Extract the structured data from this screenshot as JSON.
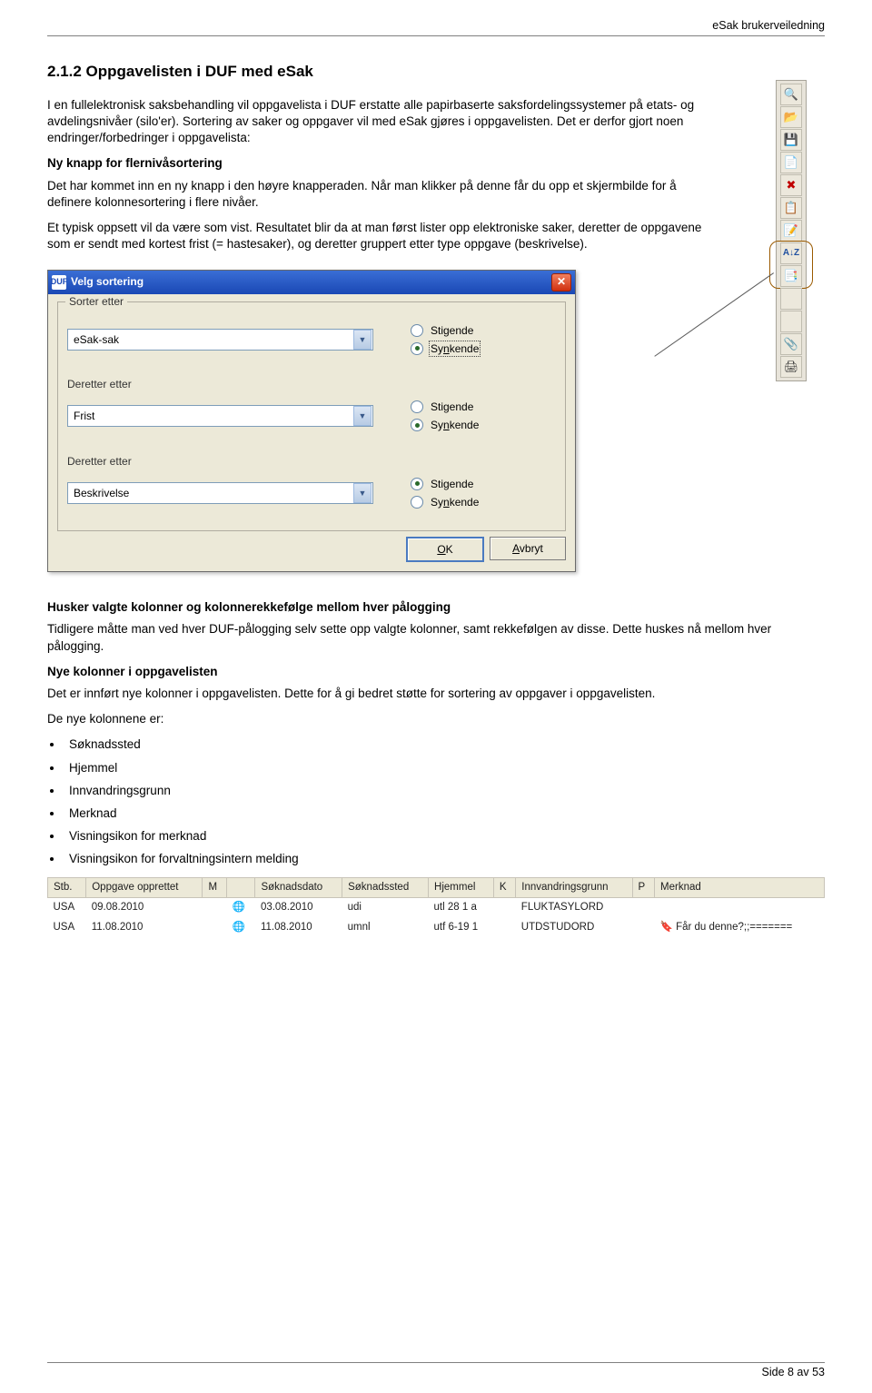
{
  "header_text": "eSak brukerveiledning",
  "section_heading": "2.1.2   Oppgavelisten i DUF med eSak",
  "para1": "I en fullelektronisk saksbehandling vil oppgavelista i DUF erstatte alle papirbaserte saksfordelingssystemer på etats- og avdelingsnivåer (silo'er). Sortering av saker og oppgaver vil med eSak gjøres i oppgavelisten. Det er derfor gjort noen endringer/forbedringer i oppgavelista:",
  "sub1_title": "Ny knapp for flernivåsortering",
  "para2": "Det har kommet inn en ny knapp i den høyre knapperaden. Når man klikker på denne får du opp et skjermbilde for å definere kolonnesortering i flere nivåer.",
  "para3": "Et typisk oppsett vil da være som vist. Resultatet blir da at man først lister opp elektroniske saker, deretter de oppgavene som er sendt med kortest frist (= hastesaker), og deretter gruppert etter type oppgave (beskrivelse).",
  "dialog": {
    "title": "Velg sortering",
    "group_legend": "Sorter etter",
    "row1": {
      "label": "",
      "field": "eSak-sak",
      "radio_stigende": "Stigende",
      "radio_synkende": "Synkende",
      "selected": "synkende",
      "deretter_label": "Deretter etter"
    },
    "row2": {
      "field": "Frist",
      "radio_stigende": "Stigende",
      "radio_synkende": "Synkende",
      "selected": "synkende",
      "deretter_label": "Deretter etter"
    },
    "row3": {
      "field": "Beskrivelse",
      "radio_stigende": "Stigende",
      "radio_synkende": "Synkende",
      "selected": "stigende"
    },
    "ok": "OK",
    "cancel": "Avbryt"
  },
  "sub2_title": "Husker valgte kolonner og kolonnerekkefølge mellom hver pålogging",
  "para4": "Tidligere måtte man ved hver DUF-pålogging selv sette opp valgte kolonner, samt rekkefølgen av disse. Dette huskes nå mellom hver pålogging.",
  "sub3_title": "Nye kolonner i oppgavelisten",
  "para5": "Det er innført nye kolonner i oppgavelisten. Dette for å gi bedret støtte for sortering av oppgaver i oppgavelisten.",
  "para6": "De nye kolonnene er:",
  "bullets": [
    "Søknadssted",
    "Hjemmel",
    "Innvandringsgrunn",
    "Merknad",
    "Visningsikon for merknad",
    "Visningsikon for forvaltningsintern melding"
  ],
  "table": {
    "headers": [
      "Stb.",
      "Oppgave opprettet",
      "M",
      "",
      "Søknadsdato",
      "Søknadssted",
      "Hjemmel",
      "K",
      "Innvandringsgrunn",
      "P",
      "Merknad"
    ],
    "rows": [
      {
        "stb": "USA",
        "opprettet": "09.08.2010",
        "m": "",
        "ico": "🌐",
        "sokdato": "03.08.2010",
        "soksted": "udi",
        "hjemmel": "utl 28 1 a",
        "k": "",
        "grunn": "FLUKTASYLORD",
        "p": "",
        "merk": ""
      },
      {
        "stb": "USA",
        "opprettet": "11.08.2010",
        "m": "",
        "ico": "🌐",
        "sokdato": "11.08.2010",
        "soksted": "umnl",
        "hjemmel": "utf 6-19 1",
        "k": "",
        "grunn": "UTDSTUDORD",
        "p": "",
        "merkico": "🔖",
        "merk": "Får du denne?;;======="
      }
    ]
  },
  "footer": "Side 8 av 53",
  "toolbar_icons": [
    "🔍",
    "📂",
    "💾",
    "📄",
    "✖",
    "📋",
    "📝",
    "A↓Z",
    "📑",
    "",
    "",
    "📎",
    "🖨"
  ]
}
